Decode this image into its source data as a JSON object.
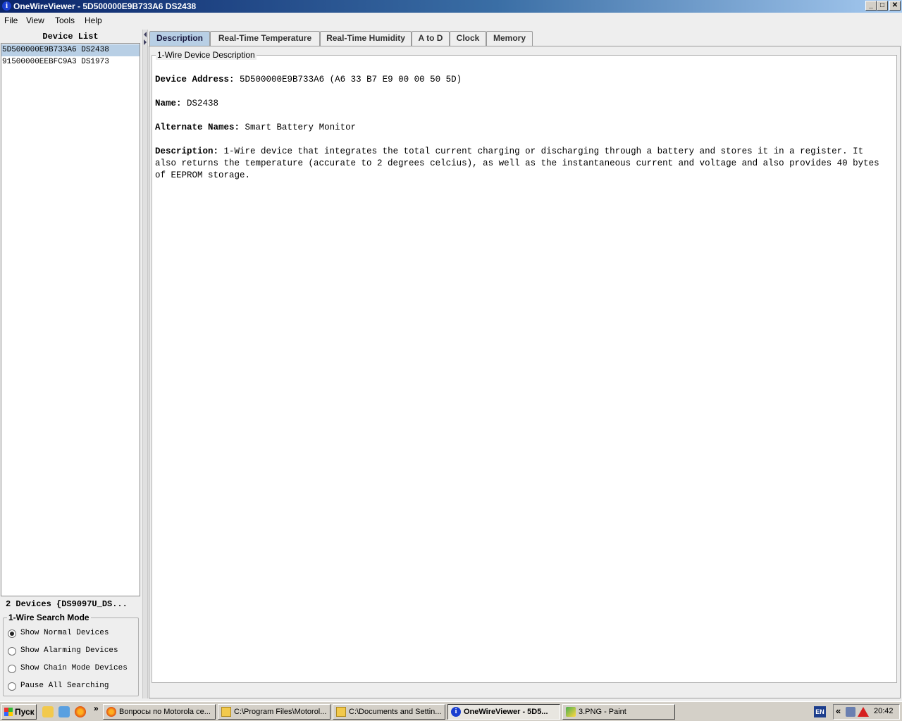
{
  "window": {
    "title": "OneWireViewer - 5D500000E9B733A6 DS2438",
    "icon": "info-icon",
    "controls": [
      "minimize",
      "maximize",
      "close"
    ]
  },
  "menu": [
    "File",
    "View",
    "Tools",
    "Help"
  ],
  "device_list": {
    "header": "Device List",
    "items": [
      {
        "label": "5D500000E9B733A6 DS2438",
        "selected": true
      },
      {
        "label": "91500000EEBFC9A3 DS1973",
        "selected": false
      }
    ],
    "status": "2 Devices  {DS9097U_DS..."
  },
  "search_mode": {
    "title": "1-Wire Search Mode",
    "options": [
      {
        "label": "Show Normal Devices",
        "checked": true
      },
      {
        "label": "Show Alarming Devices",
        "checked": false
      },
      {
        "label": "Show Chain Mode Devices",
        "checked": false
      },
      {
        "label": "Pause All Searching",
        "checked": false
      }
    ]
  },
  "tabs": [
    {
      "label": "Description",
      "active": true
    },
    {
      "label": "Real-Time Temperature",
      "active": false
    },
    {
      "label": "Real-Time Humidity",
      "active": false
    },
    {
      "label": "A to D",
      "active": false
    },
    {
      "label": "Clock",
      "active": false
    },
    {
      "label": "Memory",
      "active": false
    }
  ],
  "description": {
    "group_title": "1-Wire Device Description",
    "address_label": "Device Address:",
    "address_value": "5D500000E9B733A6 (A6 33 B7 E9 00 00 50 5D)",
    "name_label": "Name:",
    "name_value": "DS2438",
    "alt_label": "Alternate Names:",
    "alt_value": "Smart Battery Monitor",
    "desc_label": "Description:",
    "desc_value": "1-Wire device that integrates the total current charging or discharging through a battery and stores it in a register. It also returns the temperature (accurate to 2 degrees celcius), as well as the instantaneous current and voltage and also provides 40 bytes of EEPROM storage."
  },
  "taskbar": {
    "start_label": "Пуск",
    "quick_launch_more": "»",
    "tasks": [
      {
        "label": "Вопросы по Motorola ce...",
        "icon": "firefox-icon",
        "active": false
      },
      {
        "label": "C:\\Program Files\\Motorol...",
        "icon": "folder-icon",
        "active": false
      },
      {
        "label": "C:\\Documents and Settin...",
        "icon": "folder-icon",
        "active": false
      },
      {
        "label": "OneWireViewer - 5D5...",
        "icon": "info-icon",
        "active": true
      },
      {
        "label": "3.PNG - Paint",
        "icon": "paint-icon",
        "active": false
      }
    ],
    "language": "EN",
    "tray_expand": "«",
    "clock": "20:42"
  },
  "colors": {
    "title_start": "#0a246a",
    "selection": "#b8cfe5",
    "window_bg": "#eeeeee",
    "taskbar_bg": "#d4d0c8"
  }
}
